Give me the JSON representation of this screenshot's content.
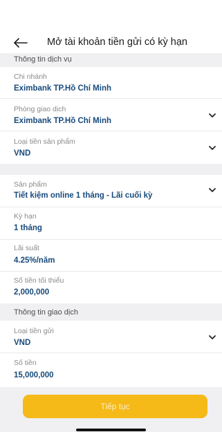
{
  "header": {
    "title": "Mở tài khoản tiền gửi có kỳ hạn",
    "back_icon": "arrow-left-icon"
  },
  "service_section": {
    "title": "Thông tin dịch vụ",
    "branch": {
      "label": "Chi nhánh",
      "value": "Eximbank TP.Hồ Chí Minh"
    },
    "transaction_office": {
      "label": "Phòng giao dịch",
      "value": "Eximbank TP.Hồ Chí Minh"
    },
    "product_currency": {
      "label": "Loại tiền sản phẩm",
      "value": "VND"
    }
  },
  "product_section": {
    "product": {
      "label": "Sản phẩm",
      "value": "Tiết kiệm online 1 tháng - Lãi cuối kỳ"
    },
    "term": {
      "label": "Kỳ hạn",
      "value": "1 tháng"
    },
    "interest_rate": {
      "label": "Lãi suất",
      "value": "4.25%/năm"
    },
    "minimum_amount": {
      "label": "Số tiền tối thiểu",
      "value": "2,000,000"
    }
  },
  "transaction_section": {
    "title": "Thông tin giao dịch",
    "deposit_currency": {
      "label": "Loại tiền gửi",
      "value": "VND"
    },
    "amount": {
      "label": "Số tiền",
      "value": "15,000,000"
    }
  },
  "footer": {
    "continue_label": "Tiếp tục",
    "button_color": "#f5b918"
  },
  "colors": {
    "value_text": "#174a7c",
    "section_bg": "#f0f0f2"
  }
}
